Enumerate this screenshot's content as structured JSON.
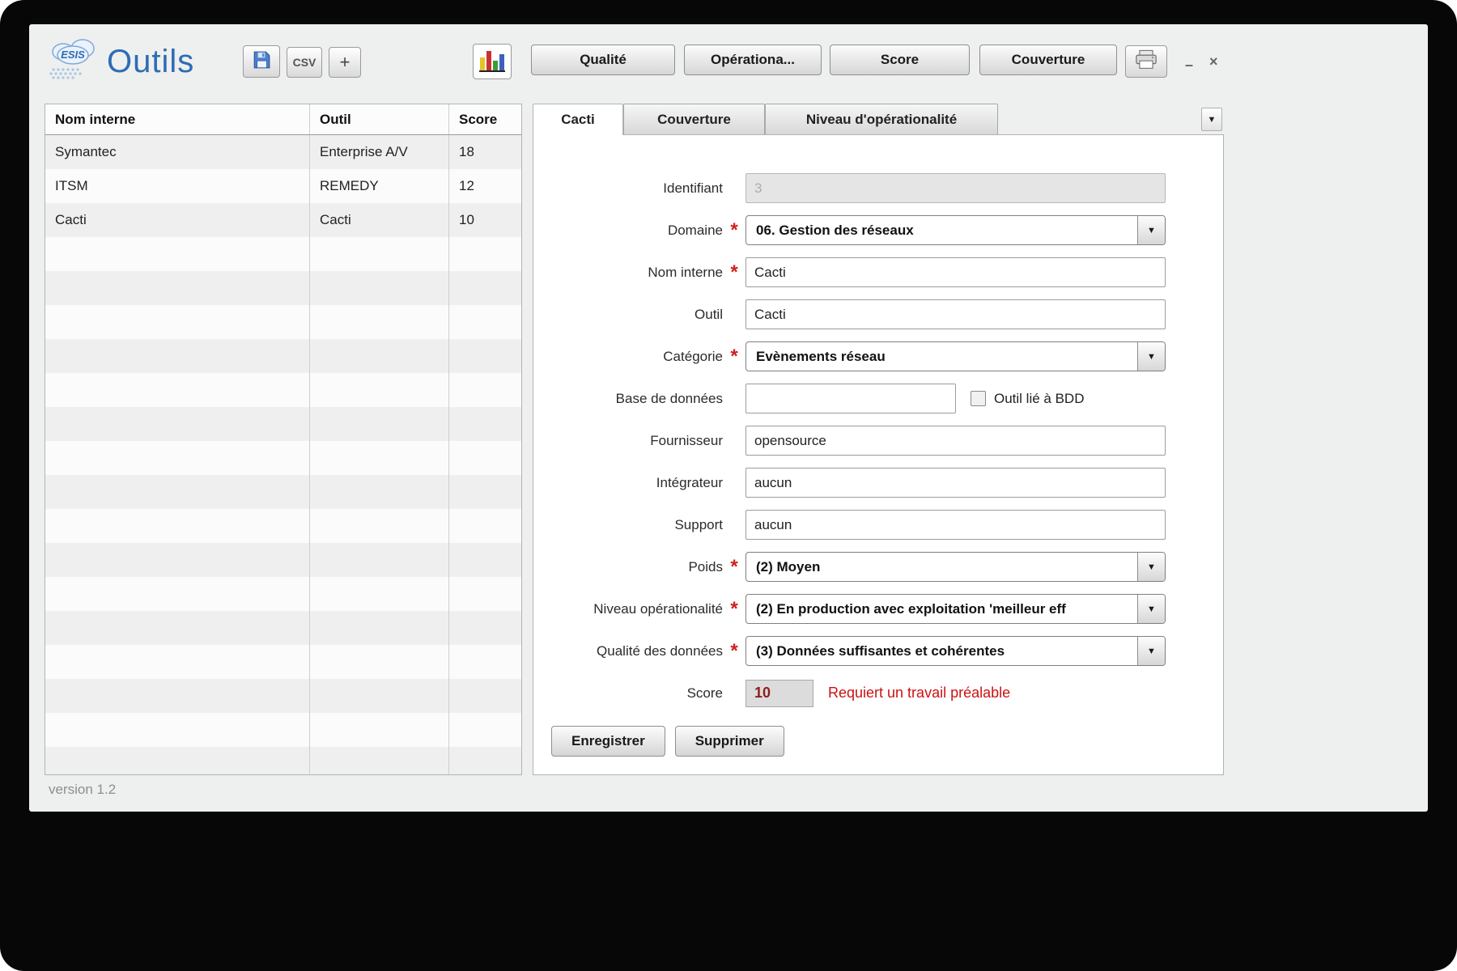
{
  "window": {
    "logo_text": "ESIS",
    "title": "Outils",
    "version": "version 1.2",
    "minimize_glyph": "–",
    "close_glyph": "×"
  },
  "icons": {
    "dropdown_arrow": "▼",
    "csv": "CSV",
    "plus": "+"
  },
  "toolbar": {
    "nav_buttons": [
      {
        "label": "Qualité"
      },
      {
        "label": "Opérationa..."
      },
      {
        "label": "Score"
      },
      {
        "label": "Couverture"
      }
    ]
  },
  "table": {
    "columns": [
      "Nom interne",
      "Outil",
      "Score"
    ],
    "rows": [
      {
        "nom": "Symantec",
        "outil": "Enterprise A/V",
        "score": "18"
      },
      {
        "nom": "ITSM",
        "outil": "REMEDY",
        "score": "12"
      },
      {
        "nom": "Cacti",
        "outil": "Cacti",
        "score": "10"
      }
    ]
  },
  "tabs": [
    {
      "label": "Cacti"
    },
    {
      "label": "Couverture"
    },
    {
      "label": "Niveau d'opérationalité"
    }
  ],
  "form": {
    "required_marker": "*",
    "identifiant": {
      "label": "Identifiant",
      "value": "3"
    },
    "domaine": {
      "label": "Domaine",
      "value": "06. Gestion des réseaux"
    },
    "nom_interne": {
      "label": "Nom interne",
      "value": "Cacti"
    },
    "outil": {
      "label": "Outil",
      "value": "Cacti"
    },
    "categorie": {
      "label": "Catégorie",
      "value": "Evènements réseau"
    },
    "base_de_donnees": {
      "label": "Base de données",
      "value": "",
      "checkbox_label": "Outil lié à BDD"
    },
    "fournisseur": {
      "label": "Fournisseur",
      "value": "opensource"
    },
    "integrateur": {
      "label": "Intégrateur",
      "value": "aucun"
    },
    "support": {
      "label": "Support",
      "value": "aucun"
    },
    "poids": {
      "label": "Poids",
      "value": "(2) Moyen"
    },
    "niveau_operationalite": {
      "label": "Niveau opérationalité",
      "value": "(2) En production avec exploitation 'meilleur eff"
    },
    "qualite_des_donnees": {
      "label": "Qualité des données",
      "value": "(3) Données suffisantes et cohérentes"
    },
    "score": {
      "label": "Score",
      "value": "10",
      "warning": "Requiert un travail préalable"
    }
  },
  "actions": {
    "save_label": "Enregistrer",
    "delete_label": "Supprimer"
  },
  "colors": {
    "title_blue": "#2d6cb4",
    "required_red": "#cc2222",
    "warning_red": "#cc1111",
    "score_red": "#8f1d1d"
  }
}
